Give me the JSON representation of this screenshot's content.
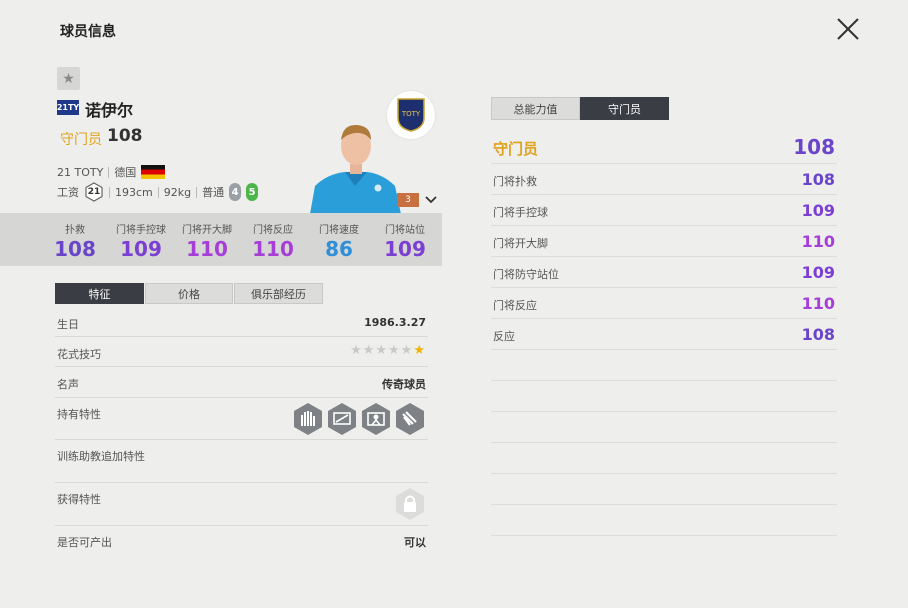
{
  "header": {
    "title": "球员信息"
  },
  "player": {
    "season_badge": "21TY",
    "name": "诺伊尔",
    "position": "守门员",
    "overall": "108",
    "season_label": "21 TOTY",
    "nation": "德国",
    "wage_label": "工资",
    "wage": "21",
    "height": "193cm",
    "weight": "92kg",
    "body_type": "普通",
    "weak_foot": "4",
    "skill_foot": "5",
    "club_badge_text": "TOTY",
    "level": "3",
    "colors": {
      "flag_black": "#111111",
      "flag_red": "#dd0000",
      "flag_gold": "#f4c300",
      "kit": "#2a9ed8"
    }
  },
  "stats": [
    {
      "label": "扑救",
      "value": "108",
      "color": "#6a45c9"
    },
    {
      "label": "门将手控球",
      "value": "109",
      "color": "#7b3fd1"
    },
    {
      "label": "门将开大脚",
      "value": "110",
      "color": "#a53fd8"
    },
    {
      "label": "门将反应",
      "value": "110",
      "color": "#a53fd8"
    },
    {
      "label": "门将速度",
      "value": "86",
      "color": "#2f8ed8"
    },
    {
      "label": "门将站位",
      "value": "109",
      "color": "#7b3fd1"
    }
  ],
  "tabs": [
    "特征",
    "价格",
    "俱乐部经历"
  ],
  "info": {
    "birthday_label": "生日",
    "birthday": "1986.3.27",
    "skill_moves_label": "花式技巧",
    "skill_stars": 1,
    "skill_stars_max": 6,
    "reputation_label": "名声",
    "reputation": "传奇球员",
    "traits_label": "持有特性",
    "traits": [
      "gk-hands-icon",
      "gk-long-throw-icon",
      "gk-goal-icon",
      "gk-gloves-icon"
    ],
    "coach_traits_label": "训练助教追加特性",
    "acquired_traits_label": "获得特性",
    "producible_label": "是否可产出",
    "producible": "可以"
  },
  "right_tabs": [
    "总能力值",
    "守门员"
  ],
  "right_stats": {
    "head": {
      "label": "守门员",
      "value": "108"
    },
    "items": [
      {
        "label": "门将扑救",
        "value": "108",
        "color": "#6a45c9"
      },
      {
        "label": "门将手控球",
        "value": "109",
        "color": "#7b3fd1"
      },
      {
        "label": "门将开大脚",
        "value": "110",
        "color": "#a53fd8"
      },
      {
        "label": "门将防守站位",
        "value": "109",
        "color": "#7b3fd1"
      },
      {
        "label": "门将反应",
        "value": "110",
        "color": "#a53fd8"
      },
      {
        "label": "反应",
        "value": "108",
        "color": "#6a45c9"
      }
    ]
  }
}
